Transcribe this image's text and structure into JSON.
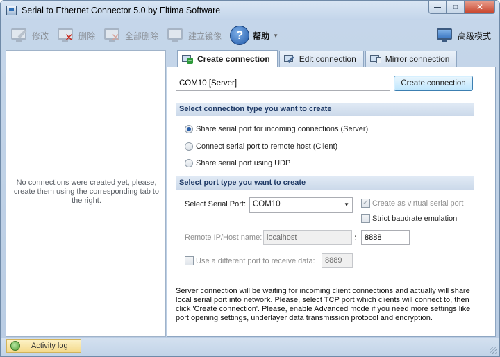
{
  "window": {
    "title": "Serial to Ethernet Connector 5.0 by Eltima Software",
    "background_title": "",
    "controls": {
      "minimize": "—",
      "maximize": "□",
      "close": "✕"
    }
  },
  "toolbar": {
    "edit_label": "修改",
    "delete_label": "删除",
    "delete_all_label": "全部删除",
    "mirror_label": "建立镜像",
    "help_label": "帮助",
    "help_glyph": "?",
    "help_caret": "▼",
    "advanced_label": "高级模式"
  },
  "left_panel": {
    "empty_message": "No connections were created yet, please, create them using the corresponding tab to the right."
  },
  "tabs": [
    {
      "label": "Create connection",
      "icon": "monitor-plus-icon",
      "active": true
    },
    {
      "label": "Edit connection",
      "icon": "monitor-edit-icon",
      "active": false
    },
    {
      "label": "Mirror connection",
      "icon": "monitor-mirror-icon",
      "active": false
    }
  ],
  "create": {
    "connection_name": "COM10 [Server]",
    "create_button": "Create connection",
    "type_header": "Select connection type you want to create",
    "types": [
      {
        "label": "Share serial port for incoming connections (Server)",
        "selected": true
      },
      {
        "label": "Connect serial port to remote host (Client)",
        "selected": false
      },
      {
        "label": "Share serial port using UDP",
        "selected": false
      }
    ],
    "port_header": "Select port type you want to create",
    "serial_port_label": "Select Serial Port:",
    "serial_port_value": "COM10",
    "serial_port_caret": "▼",
    "virtual_port_label": "Create as virtual serial port",
    "virtual_port_checked": true,
    "strict_baud_label": "Strict baudrate emulation",
    "strict_baud_checked": false,
    "remote_host_label": "Remote IP/Host name:",
    "remote_host_value": "localhost",
    "port_separator": ":",
    "port_value": "8888",
    "diff_port_label": "Use a different port to receive data:",
    "diff_port_checked": false,
    "receive_port_value": "8889",
    "description": "Server connection will be waiting for incoming client connections and actually will share local serial port into network. Please, select TCP port which clients will connect to, then click 'Create connection'. Please, enable Advanced mode if you need more settings like port opening settings, underlayer data transmission protocol and encryption."
  },
  "statusbar": {
    "activity_log": "Activity log"
  },
  "colors": {
    "accent": "#2b5fa8",
    "section_header_text": "#1f3a66",
    "delete_red": "#c9291c"
  }
}
